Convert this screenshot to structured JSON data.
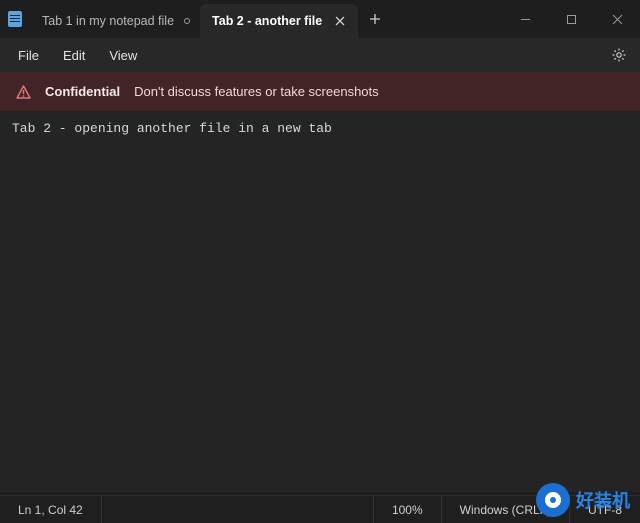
{
  "tabs": [
    {
      "label": "Tab 1 in my notepad file",
      "active": false
    },
    {
      "label": "Tab 2 - another file",
      "active": true
    }
  ],
  "menu": {
    "file": "File",
    "edit": "Edit",
    "view": "View"
  },
  "banner": {
    "title": "Confidential",
    "message": "Don't discuss features or take screenshots"
  },
  "editor": {
    "content": "Tab 2 - opening another file in a new tab"
  },
  "status": {
    "position": "Ln 1, Col 42",
    "zoom": "100%",
    "line_ending": "Windows (CRLF)",
    "encoding": "UTF-8"
  },
  "watermark": {
    "text": "好装机"
  }
}
